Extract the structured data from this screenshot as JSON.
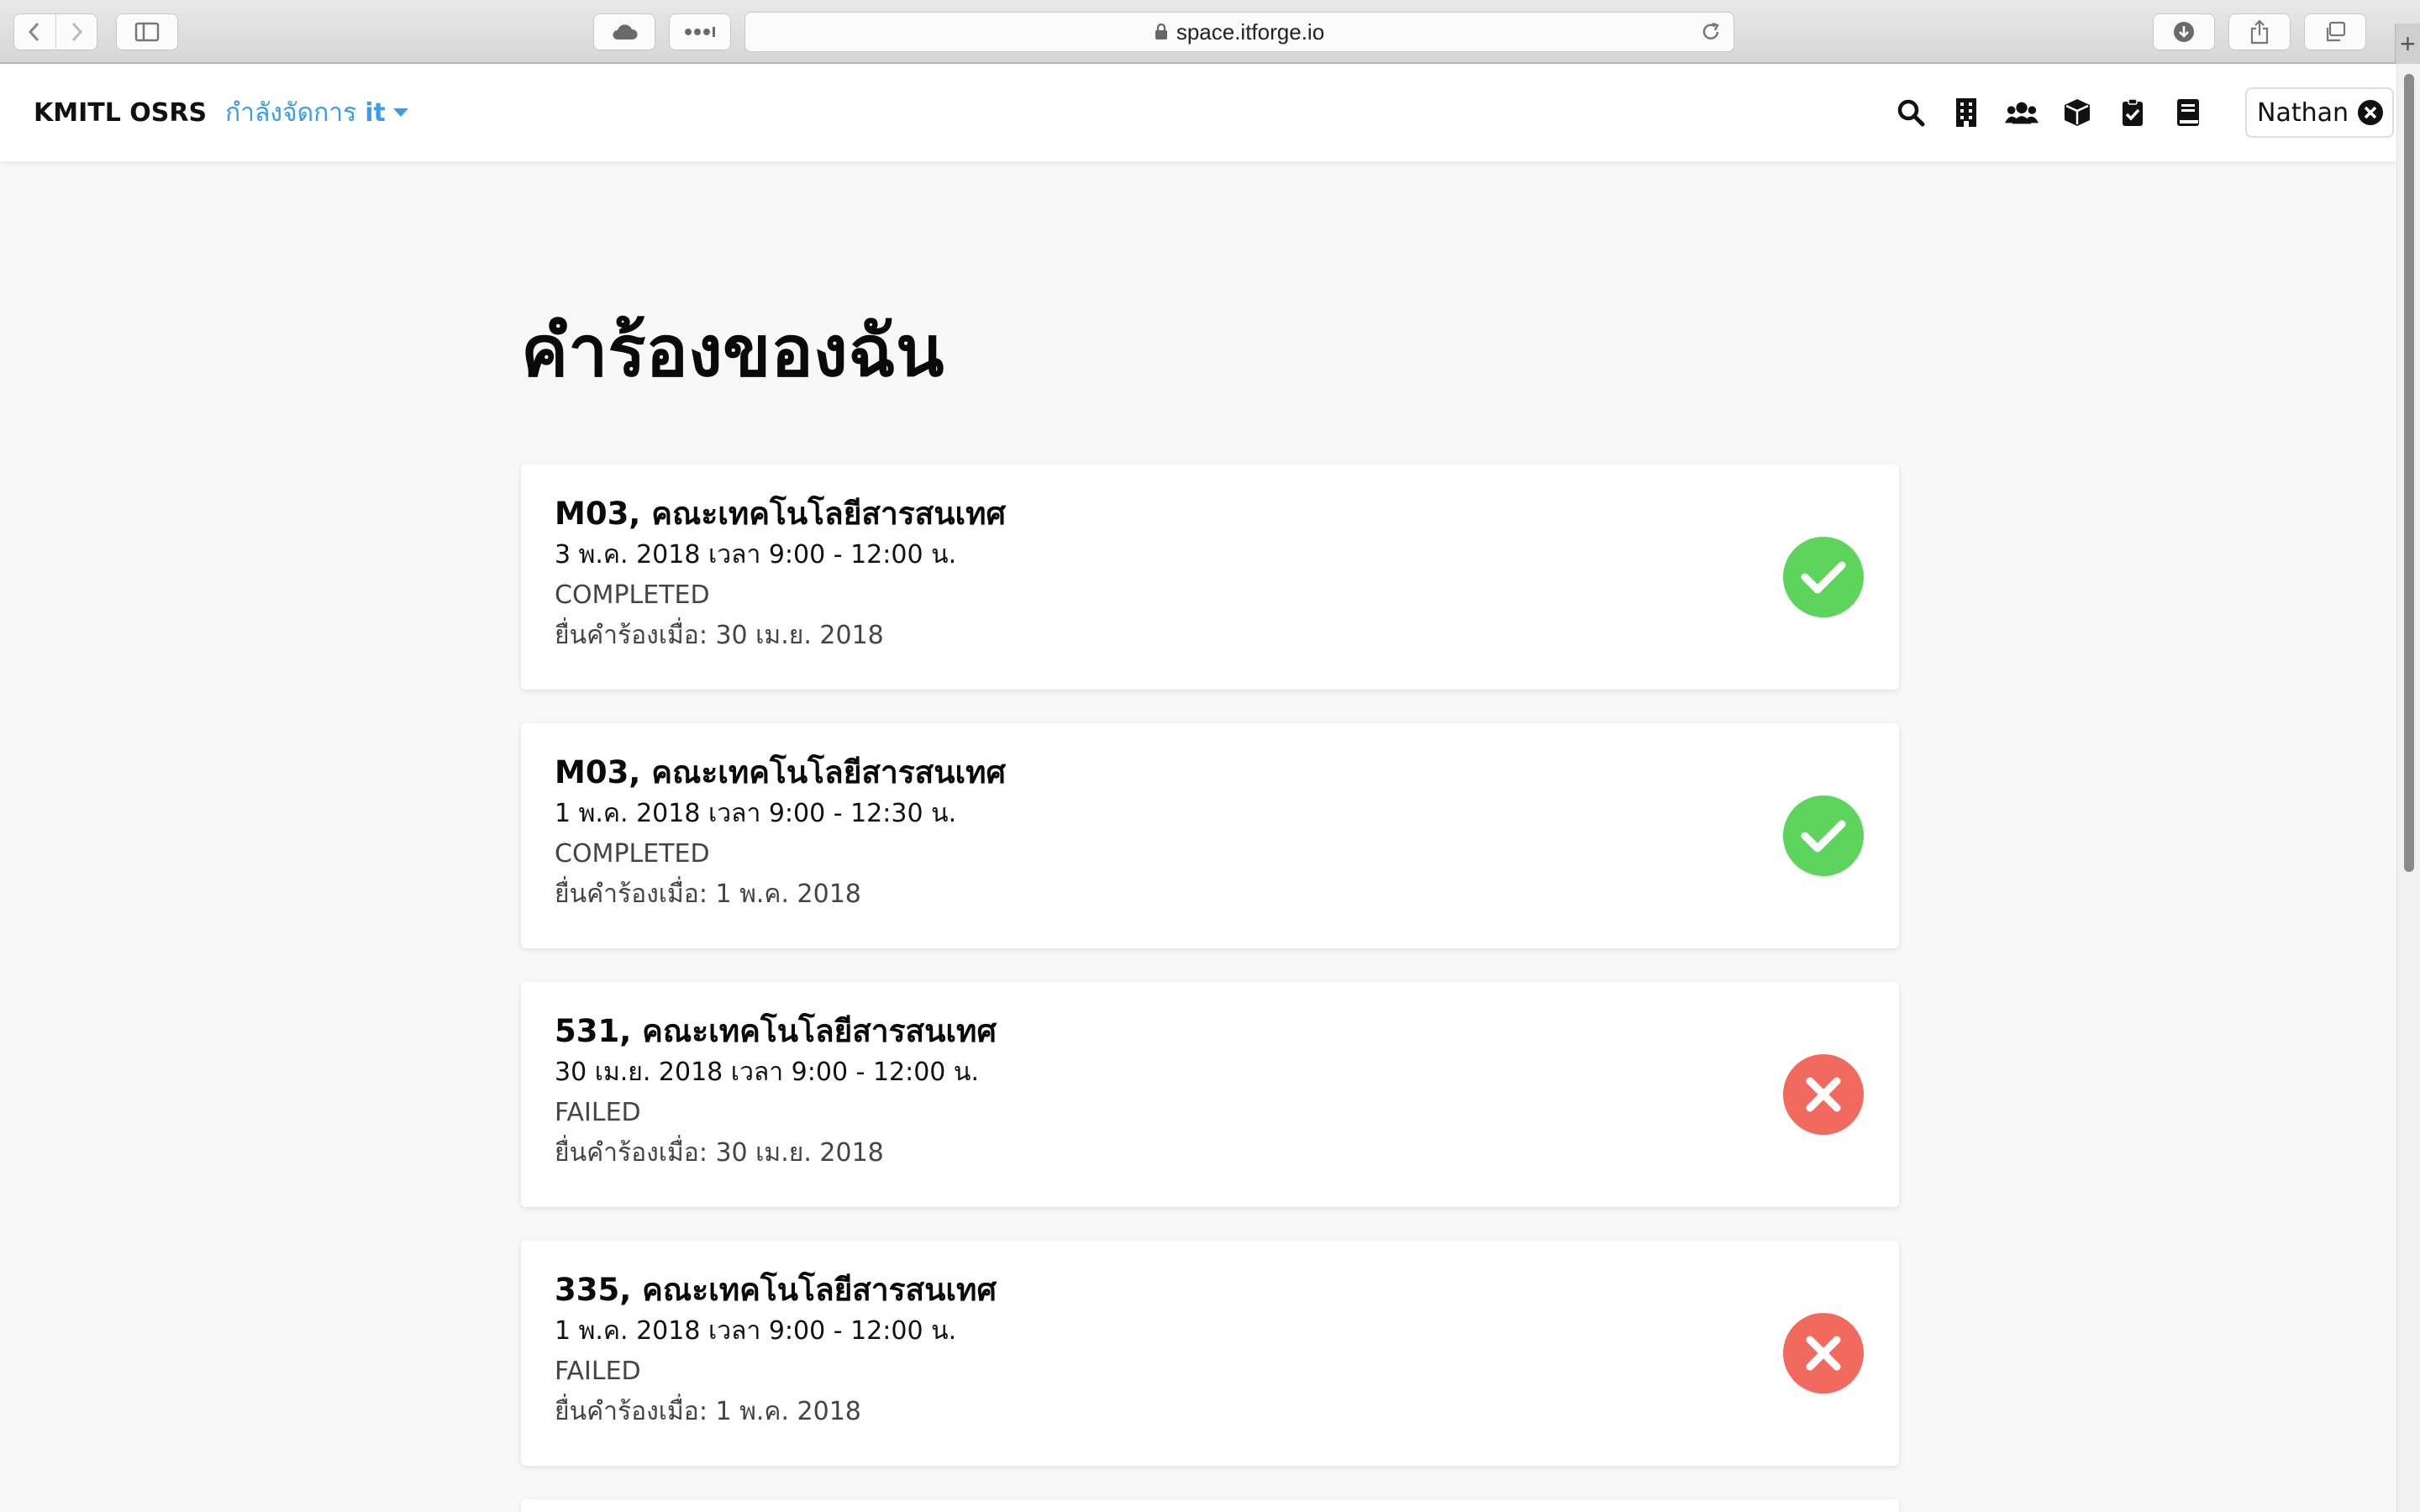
{
  "browser": {
    "url": "space.itforge.io",
    "new_tab_label": "+"
  },
  "navbar": {
    "brand": "KMITL OSRS",
    "context_prefix": "กำลังจัดการ",
    "context_name": "it",
    "icons": [
      "search-icon",
      "building-icon",
      "users-icon",
      "box-icon",
      "clipboard-check-icon",
      "book-icon"
    ],
    "user_name": "Nathan"
  },
  "page": {
    "title": "คำร้องของฉัน"
  },
  "requests": [
    {
      "room": "M03, คณะเทคโนโลยีสารสนเทศ",
      "time": "3 พ.ค. 2018 เวลา 9:00 - 12:00 น.",
      "status": "COMPLETED",
      "submitted": "ยื่นคำร้องเมื่อ: 30 เม.ย. 2018",
      "state": "ok"
    },
    {
      "room": "M03, คณะเทคโนโลยีสารสนเทศ",
      "time": "1 พ.ค. 2018 เวลา 9:00 - 12:30 น.",
      "status": "COMPLETED",
      "submitted": "ยื่นคำร้องเมื่อ: 1 พ.ค. 2018",
      "state": "ok"
    },
    {
      "room": "531, คณะเทคโนโลยีสารสนเทศ",
      "time": "30 เม.ย. 2018 เวลา 9:00 - 12:00 น.",
      "status": "FAILED",
      "submitted": "ยื่นคำร้องเมื่อ: 30 เม.ย. 2018",
      "state": "bad"
    },
    {
      "room": "335, คณะเทคโนโลยีสารสนเทศ",
      "time": "1 พ.ค. 2018 เวลา 9:00 - 12:00 น.",
      "status": "FAILED",
      "submitted": "ยื่นคำร้องเมื่อ: 1 พ.ค. 2018",
      "state": "bad"
    }
  ],
  "colors": {
    "accent": "#3a9cf0",
    "success": "#5dd55d",
    "failure": "#f26a5e"
  }
}
